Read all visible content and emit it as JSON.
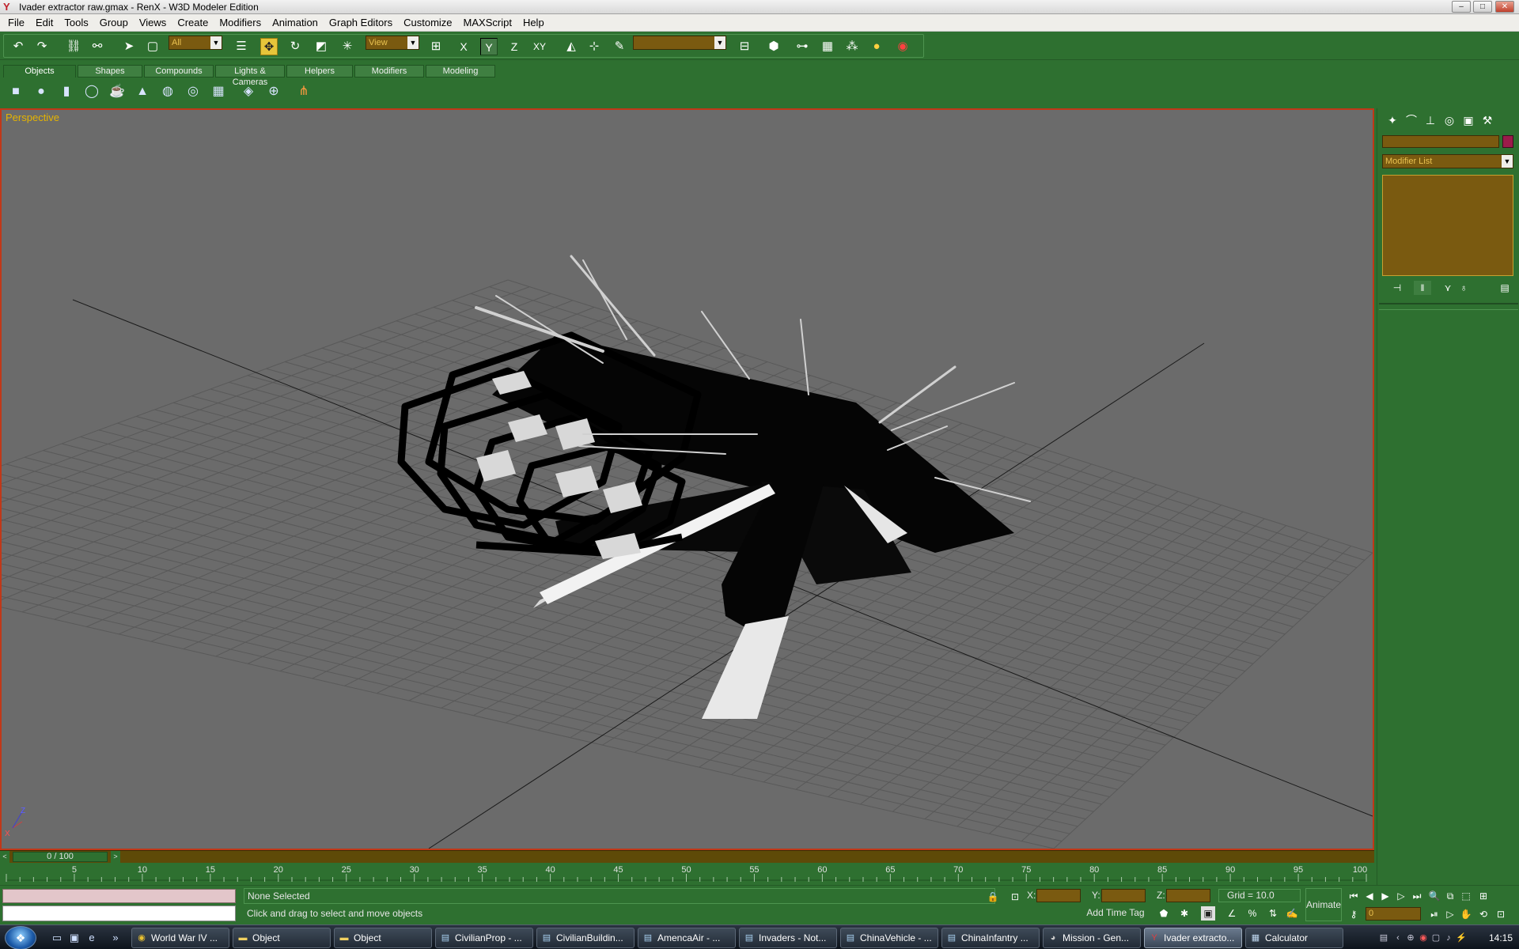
{
  "window": {
    "title": "Ivader extractor raw.gmax - RenX - W3D Modeler Edition",
    "minimize_glyph": "–",
    "maximize_glyph": "□",
    "close_glyph": "✕"
  },
  "menu": [
    "File",
    "Edit",
    "Tools",
    "Group",
    "Views",
    "Create",
    "Modifiers",
    "Animation",
    "Graph Editors",
    "Customize",
    "MAXScript",
    "Help"
  ],
  "toolbar": {
    "selection_filter": "All",
    "reference_coord": "View",
    "named_selection": "",
    "icons": [
      "undo-icon",
      "redo-icon",
      "select-link-icon",
      "unlink-icon",
      "select-icon",
      "select-region-icon",
      "select-name-icon",
      "move-icon",
      "rotate-icon",
      "scale-icon",
      "transform-gizmo-icon",
      "axis-x-icon",
      "axis-y-icon",
      "axis-z-icon",
      "axis-xy-icon",
      "mirror-icon",
      "align-icon",
      "snap-icon",
      "track-view-icon",
      "material-editor-icon",
      "schematic-icon",
      "render-icon",
      "material-id-icon",
      "color-icon",
      "quick-render-icon"
    ],
    "axis_labels": {
      "x": "X",
      "y": "Y",
      "z": "Z",
      "xy": "XY"
    }
  },
  "create_tabs": [
    "Objects",
    "Shapes",
    "Compounds",
    "Lights & Cameras",
    "Helpers",
    "Modifiers",
    "Modeling"
  ],
  "create_icons": [
    "box-icon",
    "sphere-icon",
    "cylinder-icon",
    "torus-icon",
    "teapot-icon",
    "cone-icon",
    "geosphere-icon",
    "tube-icon",
    "plane-icon",
    "grid-helper-icon",
    "patch-grid-icon",
    "bone-icon"
  ],
  "viewport": {
    "label": "Perspective",
    "axis_x": "X",
    "axis_z": "Z",
    "colors": {
      "background": "#6b6b6b",
      "grid": "#595959",
      "grid_major": "#000000",
      "border_active": "#c03818",
      "label": "#e6b400"
    }
  },
  "command_panel": {
    "tabs": [
      "create-tab-icon",
      "modify-tab-icon",
      "hierarchy-tab-icon",
      "motion-tab-icon",
      "display-tab-icon",
      "utilities-tab-icon"
    ],
    "object_name": "",
    "object_color": "#9b1b4a",
    "modifier_list": "Modifier List",
    "stack_buttons": [
      "pin-stack-icon",
      "show-end-result-icon",
      "make-unique-icon",
      "remove-modifier-icon",
      "configure-sets-icon"
    ]
  },
  "timeline": {
    "frame_indicator": "0 / 100",
    "prev_glyph": "<",
    "next_glyph": ">",
    "ticks": [
      "5",
      "10",
      "15",
      "20",
      "25",
      "30",
      "35",
      "40",
      "45",
      "50",
      "55",
      "60",
      "65",
      "70",
      "75",
      "80",
      "85",
      "90",
      "95",
      "100"
    ],
    "start": 0,
    "end": 100,
    "current": 0
  },
  "status": {
    "selection": "None Selected",
    "prompt": "Click and drag to select and move objects",
    "x_label": "X:",
    "y_label": "Y:",
    "z_label": "Z:",
    "x_value": "",
    "y_value": "",
    "z_value": "",
    "grid": "Grid = 10.0",
    "time_tag": "Add Time Tag",
    "animate": "Animate",
    "current_frame": "0"
  },
  "taskbar": {
    "start_glyph": "❖",
    "items": [
      {
        "label": "World War IV ...",
        "icon": "chrome-icon",
        "active": false
      },
      {
        "label": "Object",
        "icon": "folder-icon",
        "active": false
      },
      {
        "label": "Object",
        "icon": "folder-icon",
        "active": false
      },
      {
        "label": "CivilianProp - ...",
        "icon": "notepad-icon",
        "active": false
      },
      {
        "label": "CivilianBuildin...",
        "icon": "notepad-icon",
        "active": false
      },
      {
        "label": "AmencaAir - ...",
        "icon": "notepad-icon",
        "active": false
      },
      {
        "label": "Invaders - Not...",
        "icon": "notepad-icon",
        "active": false
      },
      {
        "label": "ChinaVehicle - ...",
        "icon": "notepad-icon",
        "active": false
      },
      {
        "label": "ChinaInfantry ...",
        "icon": "notepad-icon",
        "active": false
      },
      {
        "label": "Mission - Gen...",
        "icon": "game-icon",
        "active": false
      },
      {
        "label": "Ivader extracto...",
        "icon": "renx-icon",
        "active": true
      },
      {
        "label": "Calculator",
        "icon": "calculator-icon",
        "active": false
      }
    ],
    "clock": "14:15"
  }
}
